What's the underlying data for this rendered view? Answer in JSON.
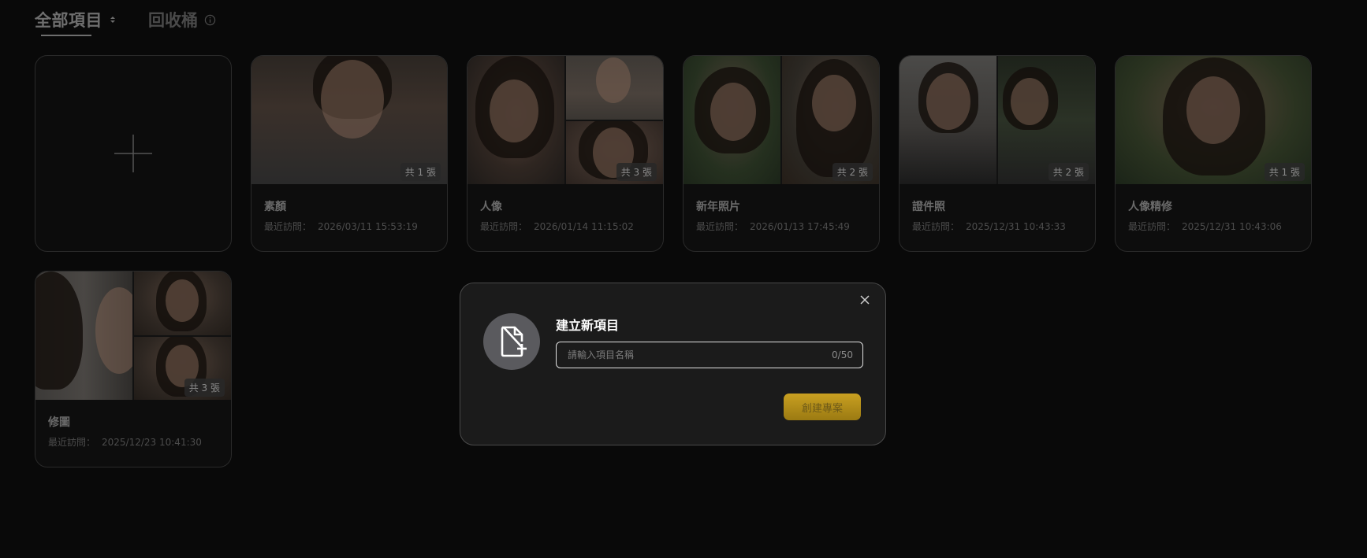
{
  "tabs": {
    "all_projects": "全部項目",
    "recycle_bin": "回收桶"
  },
  "projects": [
    {
      "title": "素顏",
      "meta_label": "最近訪問：",
      "last_visited": "2026/03/11 15:53:19",
      "count_label": "共 1 張"
    },
    {
      "title": "人像",
      "meta_label": "最近訪問：",
      "last_visited": "2026/01/14 11:15:02",
      "count_label": "共 3 張"
    },
    {
      "title": "新年照片",
      "meta_label": "最近訪問：",
      "last_visited": "2026/01/13 17:45:49",
      "count_label": "共 2 張"
    },
    {
      "title": "證件照",
      "meta_label": "最近訪問：",
      "last_visited": "2025/12/31 10:43:33",
      "count_label": "共 2 張"
    },
    {
      "title": "人像精修",
      "meta_label": "最近訪問：",
      "last_visited": "2025/12/31 10:43:06",
      "count_label": "共 1 張"
    },
    {
      "title": "修圖",
      "meta_label": "最近訪問：",
      "last_visited": "2025/12/23 10:41:30",
      "count_label": "共 3 張"
    }
  ],
  "modal": {
    "title": "建立新項目",
    "input_placeholder": "請輸入項目名稱",
    "input_value": "",
    "counter": "0/50",
    "create_button": "創建專案"
  },
  "colors": {
    "background": "#090909",
    "modal_bg": "#1b1b1b",
    "accent_gold": "#c9a021"
  }
}
